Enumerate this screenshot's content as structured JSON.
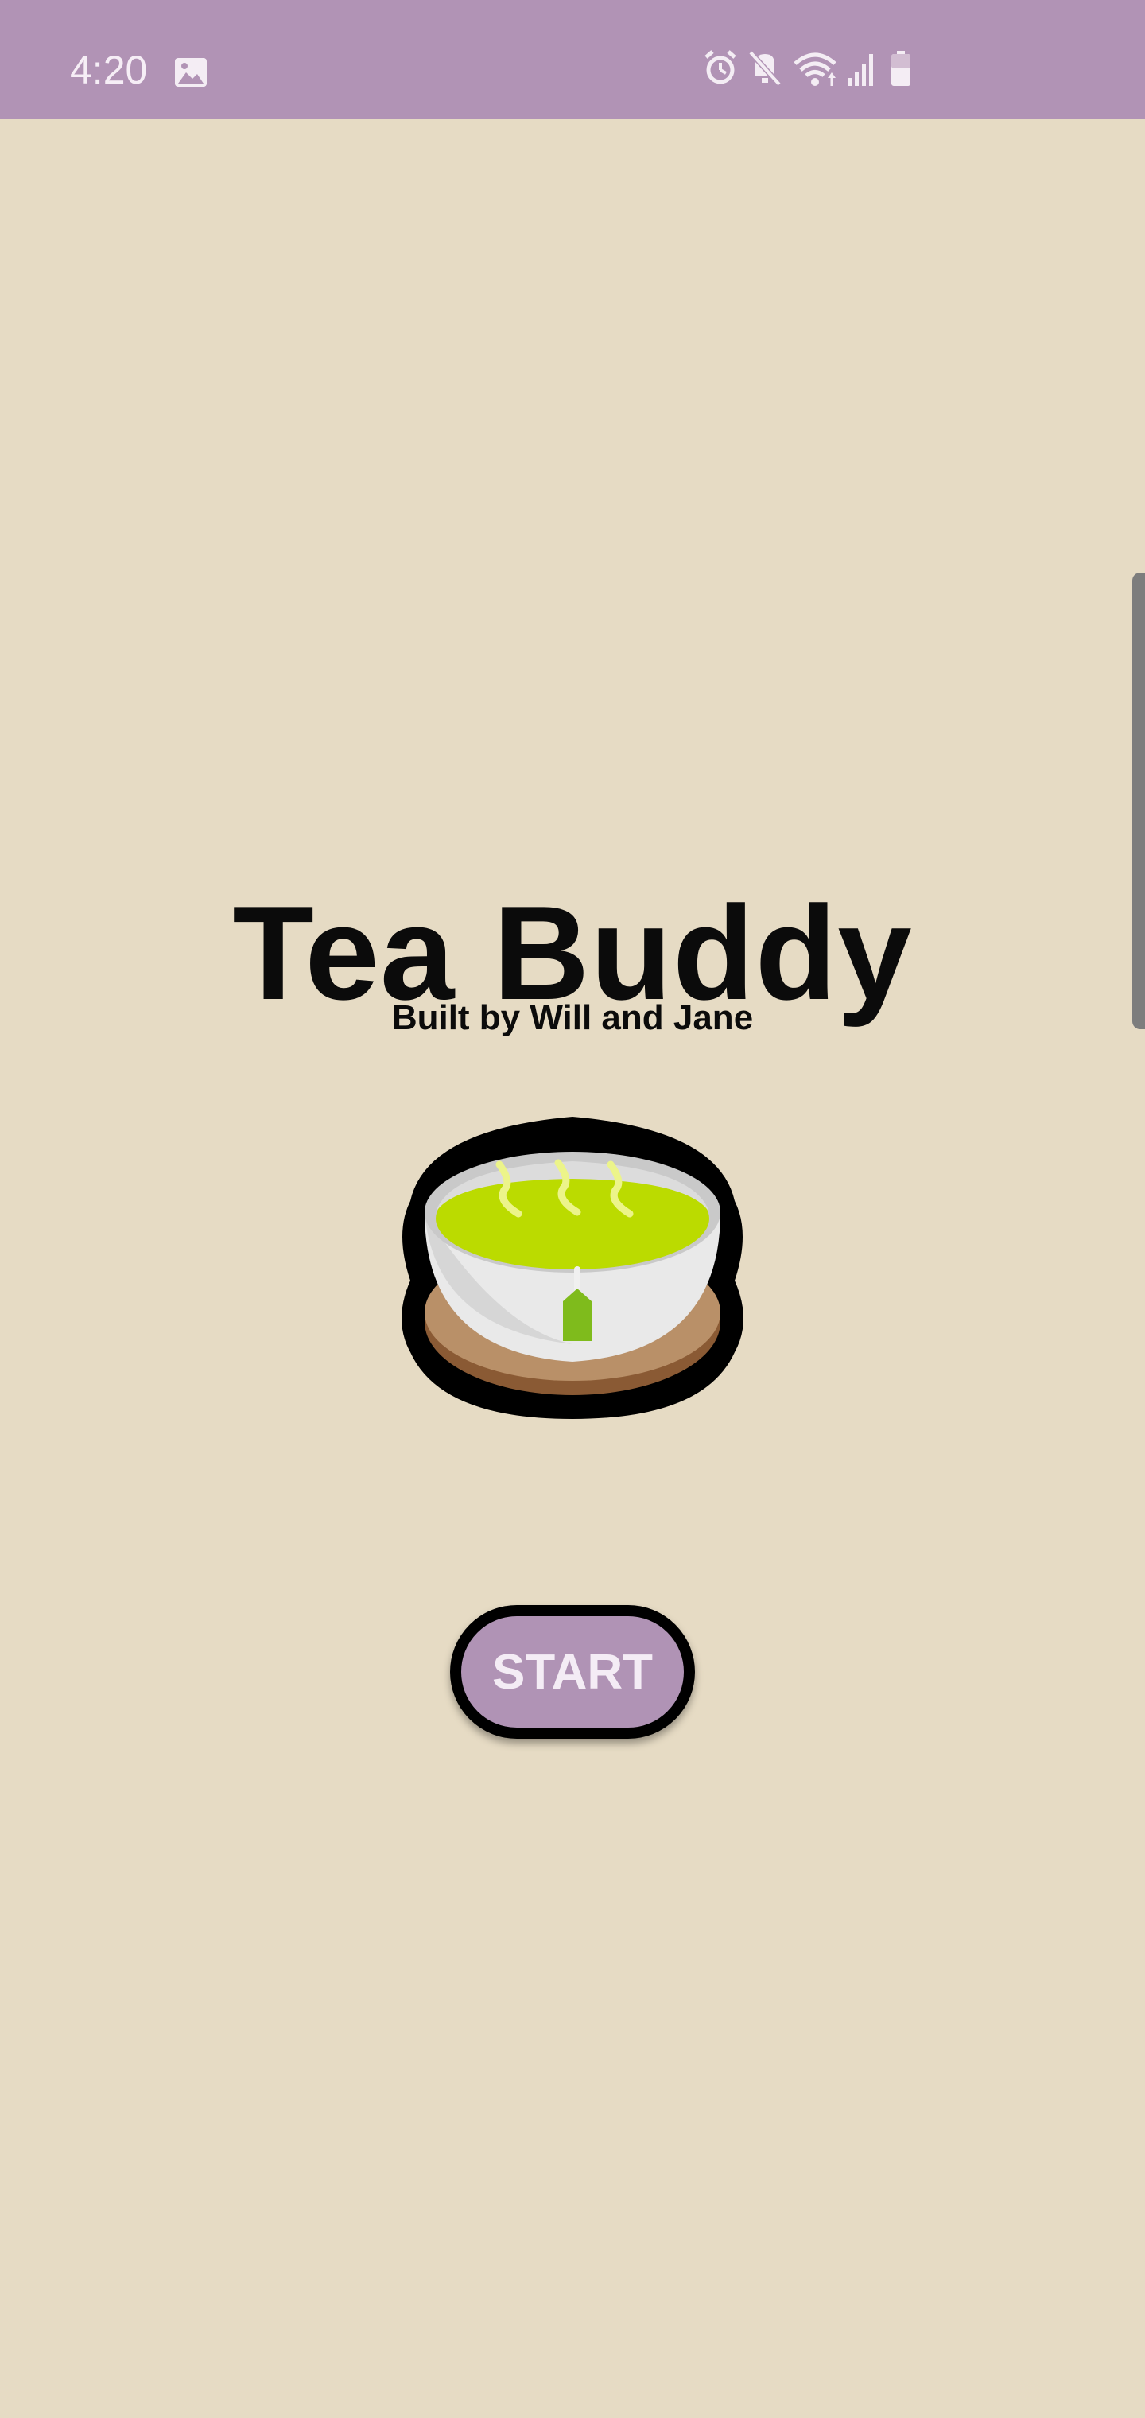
{
  "status_bar": {
    "time": "4:20",
    "icons": [
      "gallery-icon",
      "alarm-icon",
      "mute-icon",
      "wifi-icon",
      "signal-icon",
      "battery-icon"
    ],
    "background": "#b193b5"
  },
  "main": {
    "title": "Tea Buddy",
    "subtitle": "Built by Will and Jane",
    "illustration": "tea-cup-icon",
    "start_label": "START"
  },
  "colors": {
    "background": "#e6dbc4",
    "accent": "#b093b5",
    "tea": "#b8d900",
    "saucer": "#b89068"
  }
}
